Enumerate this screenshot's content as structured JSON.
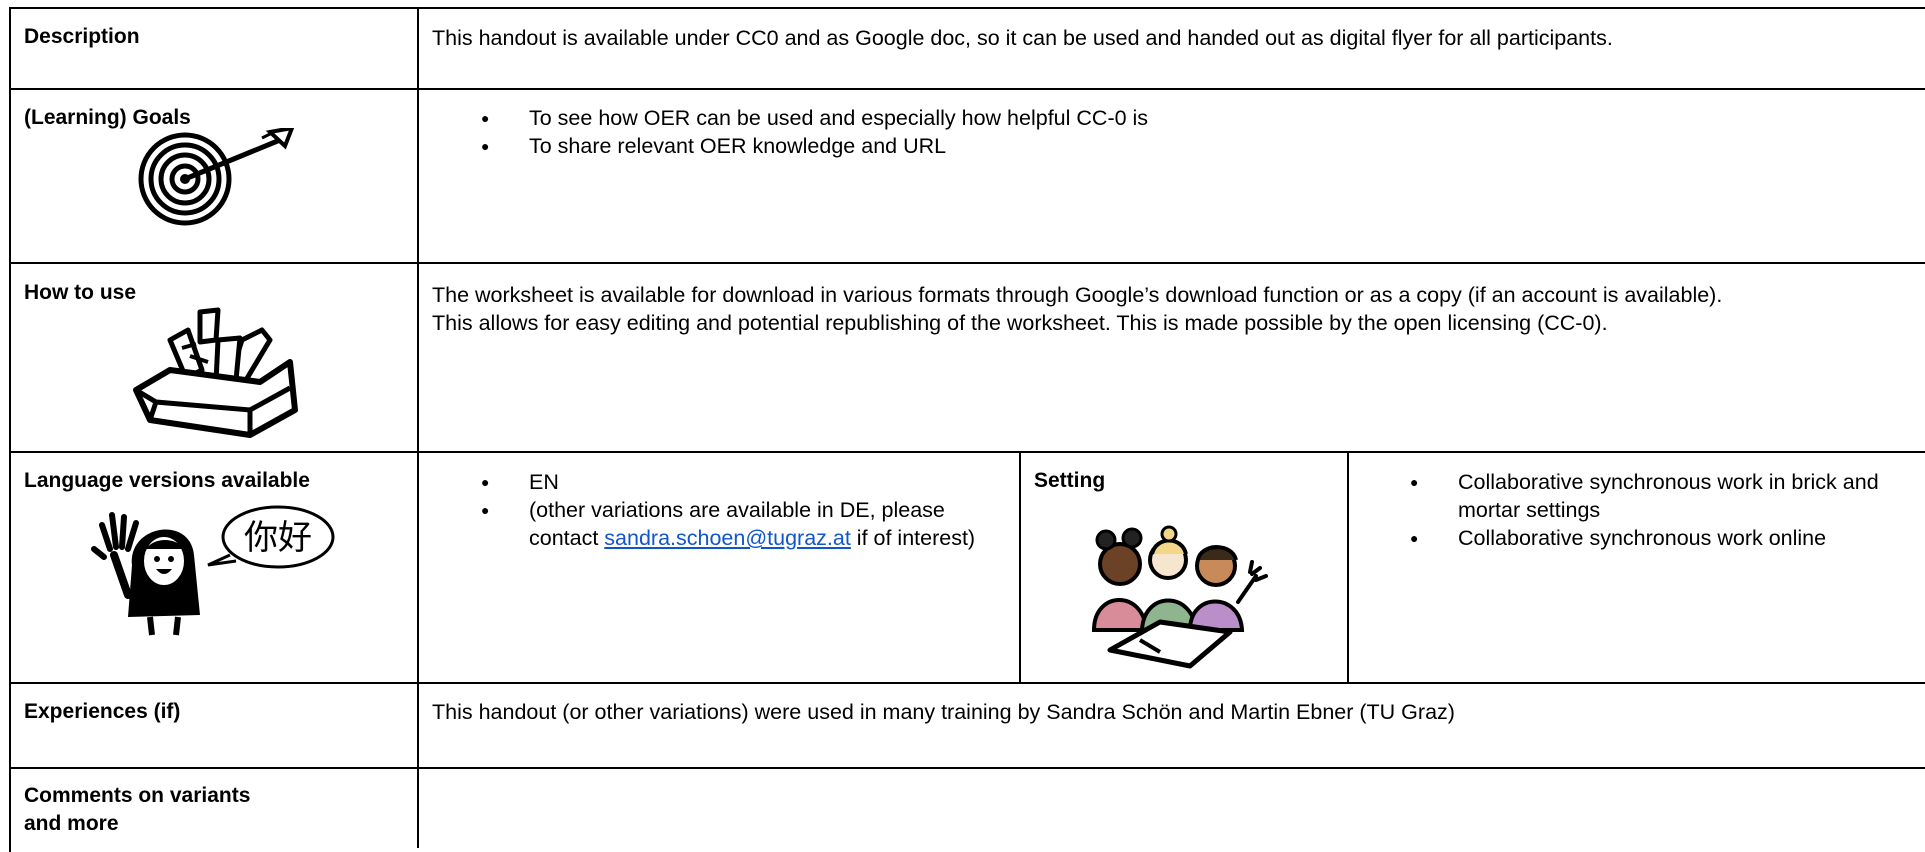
{
  "rows": {
    "description": {
      "label": "Description",
      "text": "This handout is available under CC0 and as Google doc, so it can be used and handed out as digital flyer for all participants."
    },
    "goals": {
      "label": "(Learning) Goals",
      "items": [
        "To see how OER can be used and especially how helpful CC-0 is",
        "To share relevant OER knowledge and URL"
      ],
      "icon": "target-icon"
    },
    "how_to_use": {
      "label": "How to use",
      "line1": "The worksheet is available for download in various formats through Google’s download function or as a copy (if an account is available).",
      "line2": "This allows for easy editing and potential republishing of the worksheet. This is made possible by the open licensing (CC-0).",
      "icon": "toolbox-icon"
    },
    "languages": {
      "label": "Language versions available",
      "item1": "EN",
      "item2_before": "(other variations are available in DE, please contact ",
      "item2_link": "sandra.schoen@tugraz.at",
      "item2_after": " if of interest)",
      "bubble_text": "你好",
      "icon": "greeting-person-icon"
    },
    "setting": {
      "label": "Setting",
      "items": [
        "Collaborative synchronous work in brick and mortar settings",
        "Collaborative synchronous work online"
      ],
      "icon": "group-work-icon"
    },
    "experiences": {
      "label": "Experiences (if)",
      "text": "This handout (or other variations) were used in many training by Sandra Schön and Martin Ebner (TU Graz)"
    },
    "comments": {
      "label_line1": "Comments on variants",
      "label_line2": "and more",
      "text": ""
    }
  },
  "colors": {
    "link": "#1155cc",
    "border": "#000000",
    "skin_dark": "#6b4226",
    "skin_light": "#f7e6cf",
    "shirt_pink": "#d88b98",
    "shirt_green": "#8fb58f",
    "shirt_purple": "#b98ec9"
  }
}
